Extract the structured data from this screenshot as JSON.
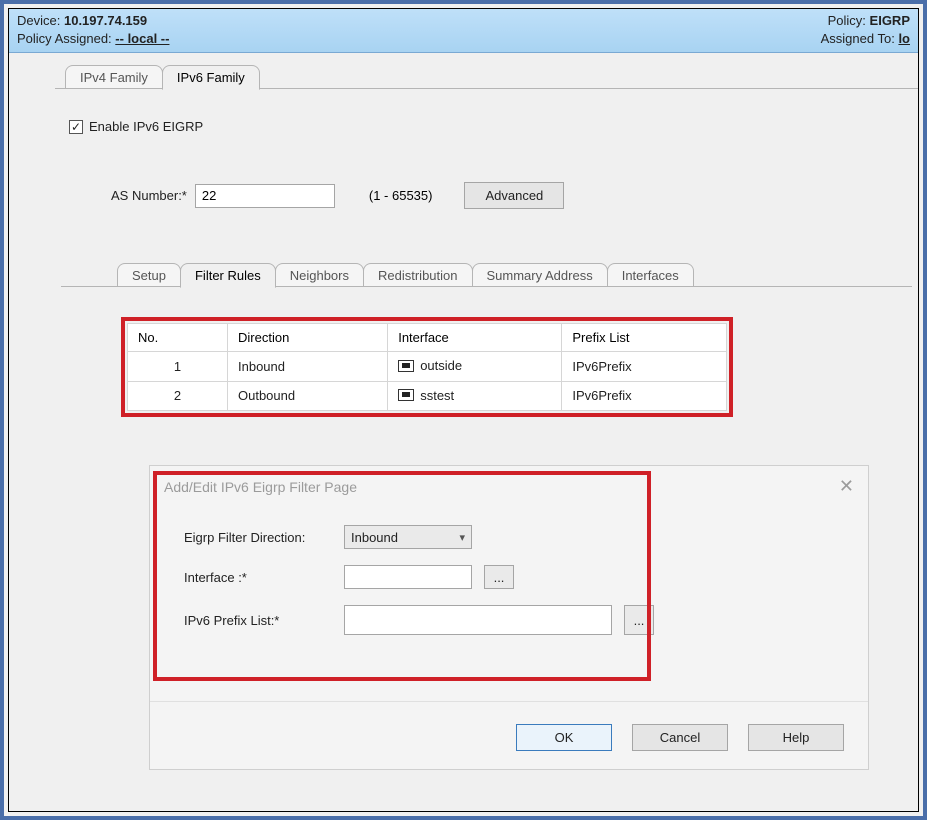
{
  "header": {
    "device_label": "Device:",
    "device_value": "10.197.74.159",
    "policy_assigned_label": "Policy Assigned:",
    "policy_assigned_value": "-- local --",
    "policy_label": "Policy:",
    "policy_value": "EIGRP",
    "assigned_to_label": "Assigned To:",
    "assigned_to_value": "lo"
  },
  "top_tabs": {
    "ipv4": "IPv4 Family",
    "ipv6": "IPv6 Family"
  },
  "enable_checkbox": {
    "checked_glyph": "✓",
    "label": "Enable IPv6 EIGRP"
  },
  "as_row": {
    "label": "AS Number:*",
    "value": "22",
    "hint": "(1 - 65535)",
    "advanced_btn": "Advanced"
  },
  "inner_tabs": {
    "setup": "Setup",
    "filter_rules": "Filter Rules",
    "neighbors": "Neighbors",
    "redistribution": "Redistribution",
    "summary_address": "Summary Address",
    "interfaces": "Interfaces"
  },
  "table": {
    "headers": {
      "no": "No.",
      "direction": "Direction",
      "interface": "Interface",
      "prefix": "Prefix List"
    },
    "rows": [
      {
        "no": "1",
        "direction": "Inbound",
        "interface": "outside",
        "prefix": "IPv6Prefix"
      },
      {
        "no": "2",
        "direction": "Outbound",
        "interface": "sstest",
        "prefix": "IPv6Prefix"
      }
    ]
  },
  "dialog": {
    "title": "Add/Edit IPv6 Eigrp Filter Page",
    "direction_label": "Eigrp Filter Direction:",
    "direction_value": "Inbound",
    "interface_label": "Interface :*",
    "interface_value": "",
    "prefix_label": "IPv6 Prefix List:*",
    "prefix_value": "",
    "browse_glyph": "...",
    "ok": "OK",
    "cancel": "Cancel",
    "help": "Help"
  }
}
